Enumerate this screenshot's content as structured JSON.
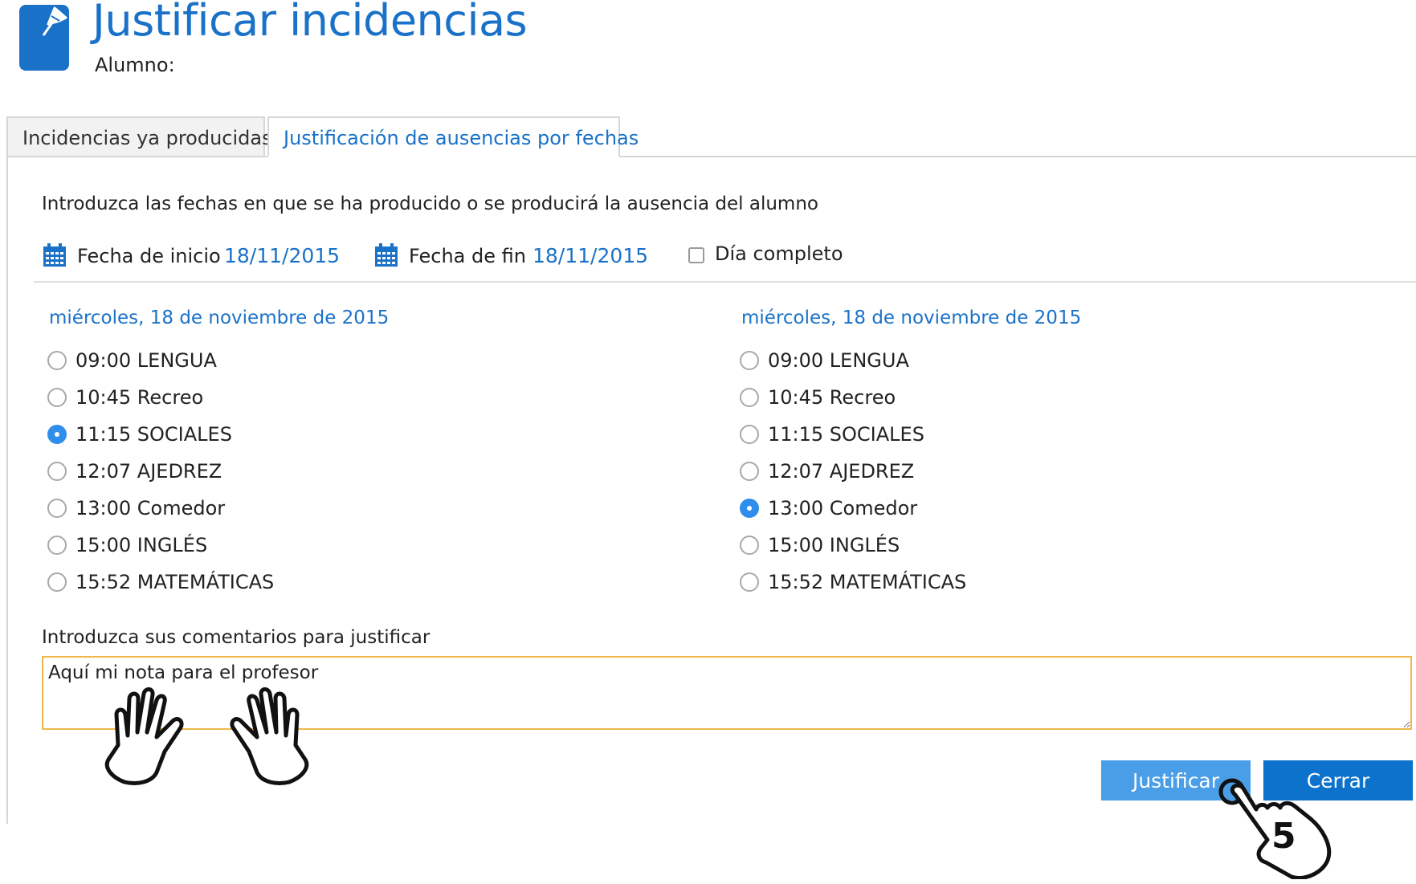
{
  "header": {
    "title": "Justificar incidencias",
    "student_label": "Alumno:",
    "icon": "pushpin-document-icon",
    "accent_color": "#1a72c8"
  },
  "tabs": [
    {
      "label": "Incidencias ya producidas",
      "active": false
    },
    {
      "label": "Justificación de ausencias por fechas",
      "active": true
    }
  ],
  "form": {
    "instructions": "Introduzca las fechas en que se ha producido o se producirá la ausencia del alumno",
    "start_date_label": "Fecha de inicio",
    "start_date_value": "18/11/2015",
    "end_date_label": "Fecha de fin",
    "end_date_value": "18/11/2015",
    "full_day_label": "Día completo",
    "full_day_checked": false
  },
  "columns": {
    "start": {
      "date": "miércoles, 18 de noviembre de 2015",
      "selected": "11:15 SOCIALES",
      "slots": [
        "09:00 LENGUA",
        "10:45 Recreo",
        "11:15 SOCIALES",
        "12:07 AJEDREZ",
        "13:00 Comedor",
        "15:00 INGLÉS",
        "15:52 MATEMÁTICAS"
      ]
    },
    "end": {
      "date": "miércoles, 18 de noviembre de 2015",
      "selected": "13:00 Comedor",
      "slots": [
        "09:00 LENGUA",
        "10:45 Recreo",
        "11:15 SOCIALES",
        "12:07 AJEDREZ",
        "13:00 Comedor",
        "15:00 INGLÉS",
        "15:52 MATEMÁTICAS"
      ]
    }
  },
  "comments": {
    "label": "Introduzca sus comentarios para justificar",
    "value": "Aquí mi nota para el profesor"
  },
  "buttons": {
    "justify": "Justificar",
    "close": "Cerrar"
  },
  "annotation": {
    "step": "5",
    "icons": [
      "typing-hands-icon",
      "pointing-hand-icon"
    ]
  }
}
